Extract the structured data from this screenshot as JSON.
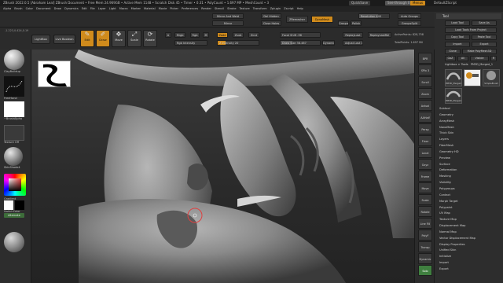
{
  "app": {
    "title": "ZBrush 2022.0.5 [Abraham Leal] ZBrush Document • Free Mem 24.969GB • Active Mem 1148 • Scratch Disk 45 • Timer • 0.31 • PolyCount • 1.697 MP • MeshCount • 3",
    "quicksave": "QuickSave",
    "see_through": "See-through 0",
    "menus": "Menus",
    "default_script": "DefaultZScript"
  },
  "menubar": [
    "Alpha",
    "Brush",
    "Color",
    "Document",
    "Draw",
    "Dynamics",
    "Edit",
    "File",
    "Layer",
    "Light",
    "Macro",
    "Marker",
    "Material",
    "Movie",
    "Picker",
    "Preferences",
    "Render",
    "Stencil",
    "Stroke",
    "Texture",
    "Transform",
    "Zplugin",
    "Zscript",
    "Help"
  ],
  "shelf": {
    "mirror_and_weld": "Mirror And Weld",
    "del_hidden": "Del Hidden",
    "mirror": "Mirror",
    "close_holes": "Close Holes",
    "zremesher": "ZRemesher",
    "zremesher_guides": "ZRemesher",
    "dynamesh": "DynaMesh",
    "group": "Groups",
    "polish": "Polish",
    "resolution": "Resolution 440",
    "auto_groups": "Auto Groups",
    "group_split": "GroupsSplit"
  },
  "bar2": {
    "coords": "-1.223,0.424,0.19",
    "lightbox": "LightBox",
    "live_boolean": "Live Boolean",
    "edit": "Edit",
    "draw": "Draw",
    "move": "Move",
    "scale": "Scale",
    "rotate": "Rotate",
    "a_label": "A",
    "mrgb": "Mrgb",
    "rgb": "Rgb",
    "m": "M",
    "zadd": "Zadd",
    "zsub": "Zsub",
    "zcut": "Zcut",
    "rgb_intensity": "Rgb Intensity",
    "z_intensity": "Z Intensity 20",
    "focal_shift": "Focal Shift -96",
    "draw_size": "Draw Size 38.467",
    "dynamic": "Dynamic",
    "replay_last": "ReplayLast",
    "replay_last_rel": "ReplayLastRel",
    "active_points": "ActivePoints: 828,758",
    "total_points": "TotalPoints: 1.697 Mil",
    "adjust": "Adjust Last 1"
  },
  "lefttray": {
    "brush": "ClayBuildup",
    "stroke": "FreeHand",
    "alpha": "~BrushAlpha",
    "texture": "Texture Off",
    "material": "SkinShade4",
    "gradient": "Gradient",
    "switch_color": "SwitchColor",
    "alternate": "Alternate"
  },
  "rtools": [
    "BPR",
    "SPix 3",
    "Scroll",
    "Zoom",
    "Actual",
    "AAHalf",
    "Persp",
    "Floor",
    "Local",
    "Gxyz",
    "Frame",
    "Move",
    "Scale",
    "Rotate",
    "Line Fill",
    "PolyF",
    "Transp",
    "Dynamic",
    "Solo"
  ],
  "tool_panel": {
    "title": "Tool",
    "load_tool": "Load Tool",
    "save_as": "Save As",
    "load_tools_from_project": "Load Tools From Project",
    "copy_tool": "Copy Tool",
    "paste_tool": "Paste Tool",
    "import": "Import",
    "export": "Export",
    "clone": "Clone",
    "make_polymesh": "Make PolyMesh3D",
    "goz": "GoZ",
    "all": "All",
    "visible": "Visible",
    "r": "R",
    "lightbox_tools": "Lightbox > Tools",
    "current_tool": "PM3D_Merged_1",
    "thumbs": [
      "PM3D_Merged_1",
      "SimpleBrush",
      "PM3D_Merged_1"
    ],
    "subpalettes": [
      "Subtool",
      "Geometry",
      "ArrayMesh",
      "NanoMesh",
      "Thick Skin",
      "Layers",
      "FiberMesh",
      "Geometry HD",
      "Preview",
      "Surface",
      "Deformation",
      "Masking",
      "Visibility",
      "Polygroups",
      "Contact",
      "Morph Target",
      "Polypaint",
      "UV Map",
      "Texture Map",
      "Displacement Map",
      "Normal Map",
      "Vector Displacement Map",
      "Display Properties",
      "Unified Skin",
      "Initialize",
      "Import",
      "Export"
    ]
  },
  "colors": {
    "accent": "#d08b1c",
    "green": "#3f7f3f",
    "brush_ring": "#e04040"
  }
}
